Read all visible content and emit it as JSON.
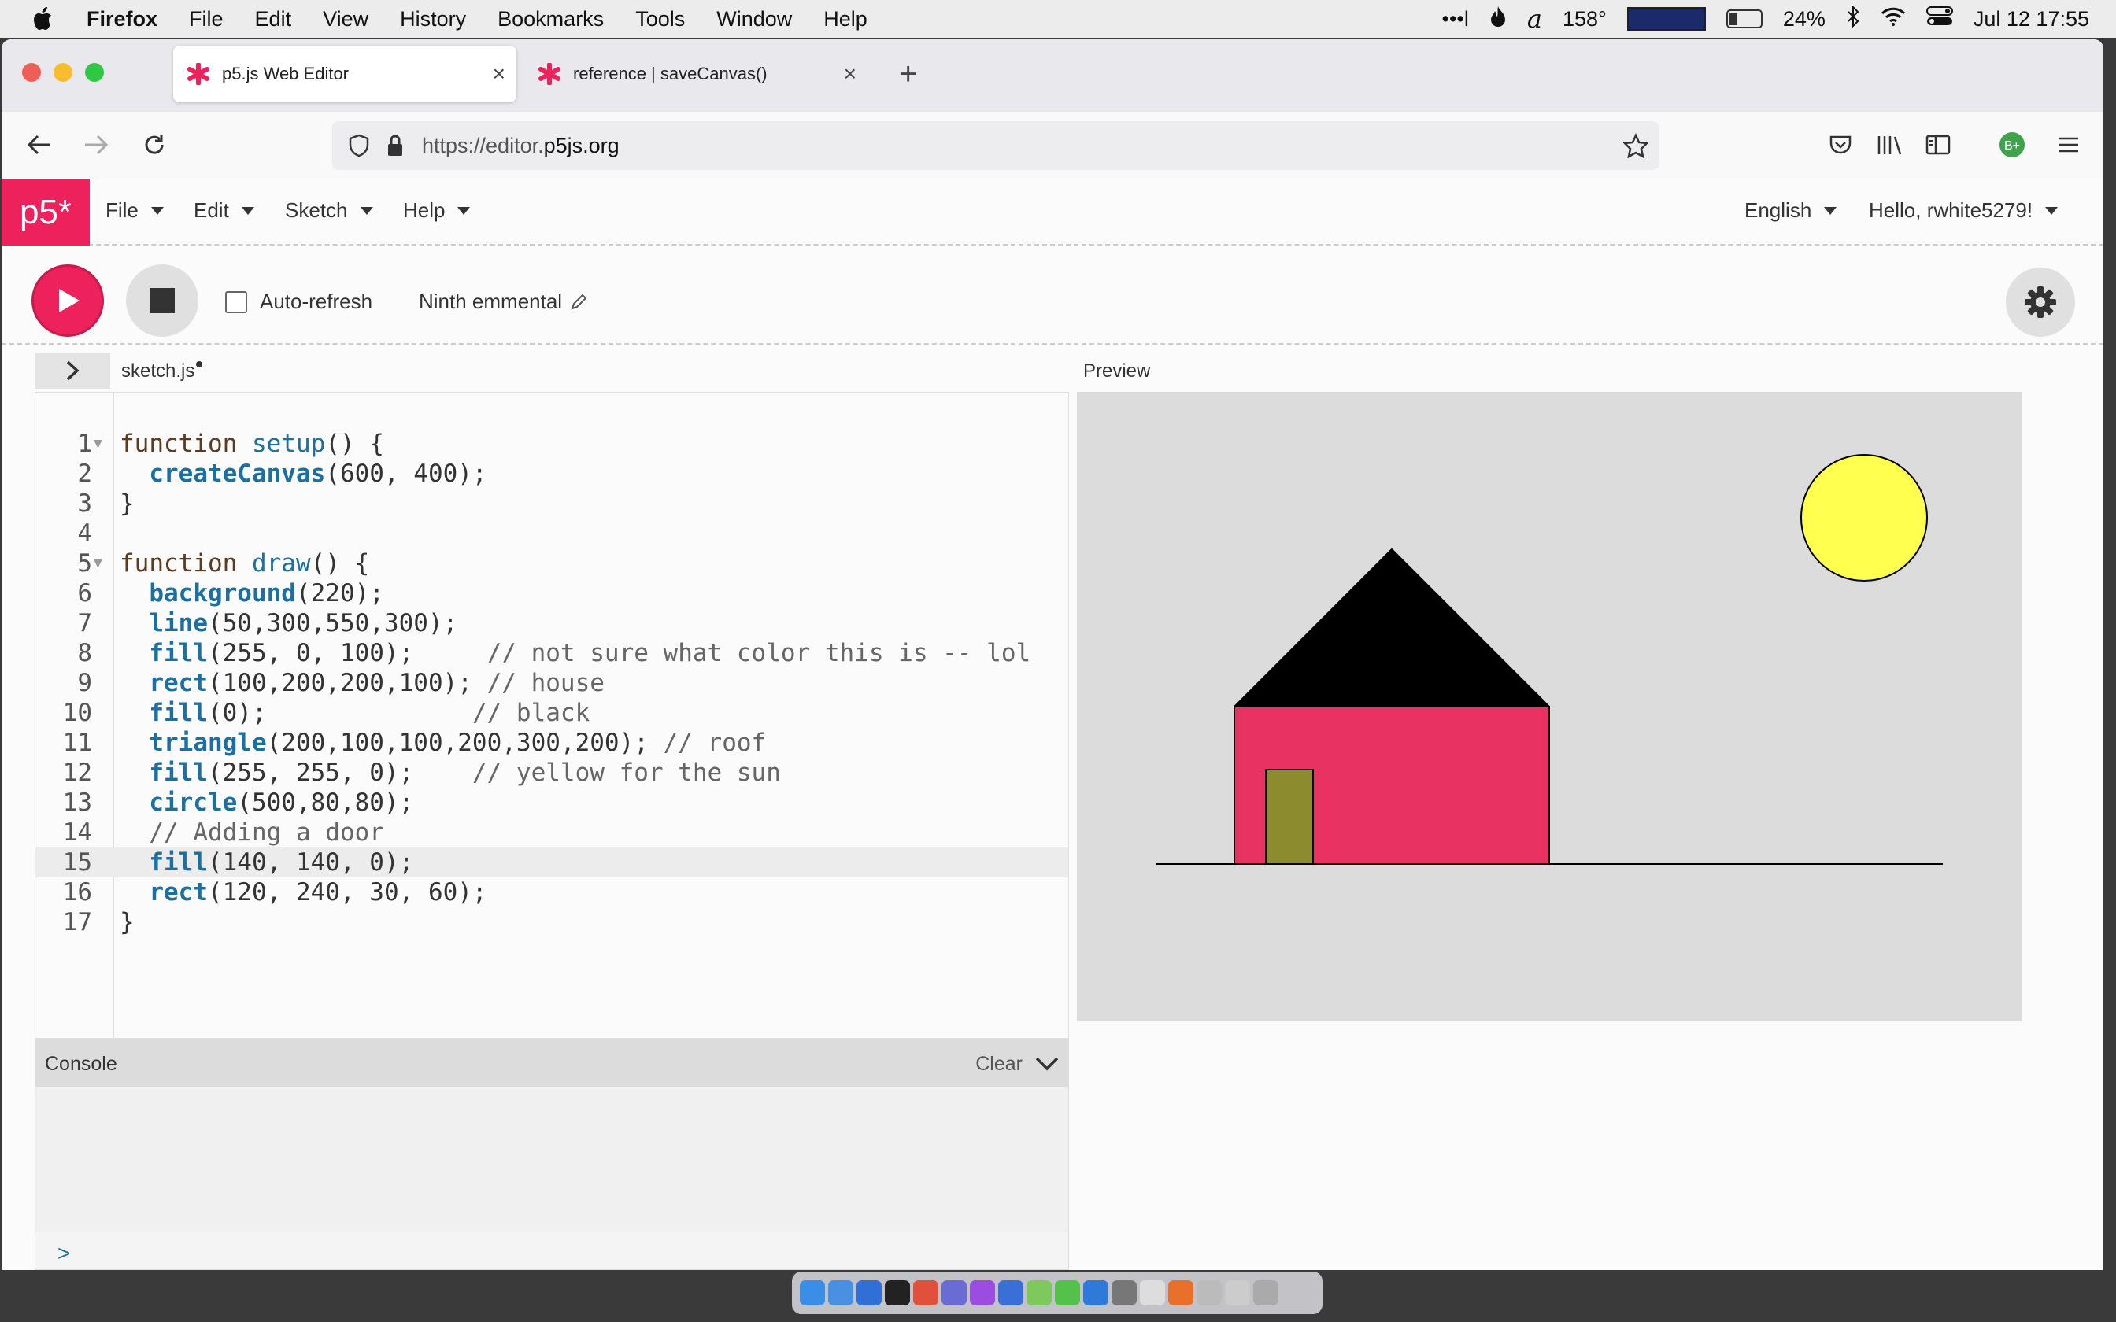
{
  "menubar": {
    "app_name": "Firefox",
    "items": [
      "File",
      "Edit",
      "View",
      "History",
      "Bookmarks",
      "Tools",
      "Window",
      "Help"
    ],
    "temperature": "158°",
    "battery": "24%",
    "clock": "Jul 12  17:55"
  },
  "browser": {
    "tabs": [
      {
        "title": "p5.js Web Editor",
        "active": true
      },
      {
        "title": "reference | saveCanvas()",
        "active": false
      }
    ],
    "url_prefix": "https://editor.",
    "url_domain": "p5js.org"
  },
  "p5_menu": {
    "logo": "p5*",
    "items": [
      "File",
      "Edit",
      "Sketch",
      "Help"
    ],
    "language": "English",
    "user": "Hello, rwhite5279!"
  },
  "toolbar": {
    "autorefresh_label": "Auto-refresh",
    "sketch_name": "Ninth emmental"
  },
  "files": {
    "current": "sketch.js",
    "preview_label": "Preview"
  },
  "code": [
    {
      "n": "1",
      "fold": true,
      "t": [
        [
          "kw",
          "function "
        ],
        [
          "fn",
          "setup"
        ],
        [
          "pl",
          "() {"
        ]
      ]
    },
    {
      "n": "2",
      "t": [
        [
          "pl",
          "  "
        ],
        [
          "bi",
          "createCanvas"
        ],
        [
          "pl",
          "(600, 400);"
        ]
      ]
    },
    {
      "n": "3",
      "t": [
        [
          "pl",
          "}"
        ]
      ]
    },
    {
      "n": "4",
      "t": [
        [
          "pl",
          ""
        ]
      ]
    },
    {
      "n": "5",
      "fold": true,
      "t": [
        [
          "kw",
          "function "
        ],
        [
          "fn",
          "draw"
        ],
        [
          "pl",
          "() {"
        ]
      ]
    },
    {
      "n": "6",
      "t": [
        [
          "pl",
          "  "
        ],
        [
          "bi",
          "background"
        ],
        [
          "pl",
          "(220);"
        ]
      ]
    },
    {
      "n": "7",
      "t": [
        [
          "pl",
          "  "
        ],
        [
          "bi",
          "line"
        ],
        [
          "pl",
          "(50,300,550,300);"
        ]
      ]
    },
    {
      "n": "8",
      "t": [
        [
          "pl",
          "  "
        ],
        [
          "bi",
          "fill"
        ],
        [
          "pl",
          "(255, 0, 100);     "
        ],
        [
          "cm",
          "// not sure what color this is -- lol"
        ]
      ]
    },
    {
      "n": "9",
      "t": [
        [
          "pl",
          "  "
        ],
        [
          "bi",
          "rect"
        ],
        [
          "pl",
          "(100,200,200,100); "
        ],
        [
          "cm",
          "// house"
        ]
      ]
    },
    {
      "n": "10",
      "t": [
        [
          "pl",
          "  "
        ],
        [
          "bi",
          "fill"
        ],
        [
          "pl",
          "(0);              "
        ],
        [
          "cm",
          "// black"
        ]
      ]
    },
    {
      "n": "11",
      "t": [
        [
          "pl",
          "  "
        ],
        [
          "bi",
          "triangle"
        ],
        [
          "pl",
          "(200,100,100,200,300,200); "
        ],
        [
          "cm",
          "// roof"
        ]
      ]
    },
    {
      "n": "12",
      "t": [
        [
          "pl",
          "  "
        ],
        [
          "bi",
          "fill"
        ],
        [
          "pl",
          "(255, 255, 0);    "
        ],
        [
          "cm",
          "// yellow for the sun"
        ]
      ]
    },
    {
      "n": "13",
      "t": [
        [
          "pl",
          "  "
        ],
        [
          "bi",
          "circle"
        ],
        [
          "pl",
          "(500,80,80);"
        ]
      ]
    },
    {
      "n": "14",
      "t": [
        [
          "pl",
          "  "
        ],
        [
          "cm",
          "// Adding a door"
        ]
      ]
    },
    {
      "n": "15",
      "active": true,
      "t": [
        [
          "pl",
          "  "
        ],
        [
          "bi",
          "fill"
        ],
        [
          "pl",
          "(140, 140, 0);"
        ]
      ]
    },
    {
      "n": "16",
      "t": [
        [
          "pl",
          "  "
        ],
        [
          "bi",
          "rect"
        ],
        [
          "pl",
          "(120, 240, 30, 60);"
        ]
      ]
    },
    {
      "n": "17",
      "t": [
        [
          "pl",
          "}"
        ]
      ]
    }
  ],
  "console": {
    "title": "Console",
    "clear_label": "Clear",
    "prompt": ">"
  },
  "colors": {
    "p5_pink": "#ED225D",
    "house": "#E83262",
    "roof": "#000000",
    "sun": "#FFFF4F",
    "door": "#8C8C2E",
    "canvas_bg": "#DCDCDC"
  }
}
